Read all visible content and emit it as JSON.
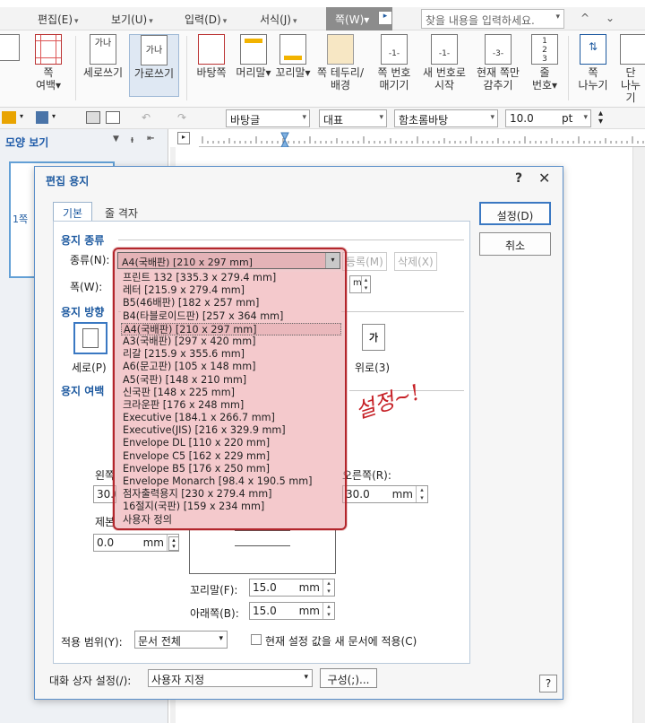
{
  "menus": [
    {
      "label": "편집(E)"
    },
    {
      "label": "보기(U)"
    },
    {
      "label": "입력(D)"
    },
    {
      "label": "서식(J)"
    },
    {
      "label": "쪽(W)"
    }
  ],
  "search": {
    "placeholder": "찾을 내용을 입력하세요."
  },
  "ribbon": {
    "items": [
      {
        "label": "쪽",
        "label2": "여백"
      },
      {
        "label": "세로쓰기",
        "label2": ""
      },
      {
        "label": "가로쓰기",
        "label2": ""
      },
      {
        "label": "바탕쪽",
        "label2": ""
      },
      {
        "label": "머리말",
        "label2": ""
      },
      {
        "label": "꼬리말",
        "label2": ""
      },
      {
        "label": "쪽 테두리/",
        "label2": "배경"
      },
      {
        "label": "쪽 번호",
        "label2": "매기기"
      },
      {
        "label": "새 번호로",
        "label2": "시작"
      },
      {
        "label": "현재 쪽만",
        "label2": "감추기"
      },
      {
        "label": "줄",
        "label2": "번호"
      },
      {
        "label": "쪽",
        "label2": "나누기"
      },
      {
        "label": "단",
        "label2": "나누기"
      }
    ],
    "icon_text": {
      "vertical": "가나",
      "horizontal": "가나"
    }
  },
  "toolbar2": {
    "style": "바탕글",
    "para": "대표",
    "font": "함초롬바탕",
    "size": "10.0",
    "unit": "pt"
  },
  "leftpane": {
    "title": "모양 보기",
    "page_label": "1쪽"
  },
  "dialog": {
    "title": "편집 용지",
    "help": "?",
    "close": "✕",
    "tabs": [
      "기본",
      "줄 격자"
    ],
    "sections": {
      "paper_type": "용지 종류",
      "orientation": "용지 방향",
      "margin": "용지 여백"
    },
    "kind_label": "종류(N):",
    "selected_paper": "A4(국배판) [210 x 297 mm]",
    "register": "등록(M)",
    "delete": "삭제(X)",
    "width_label": "폭(W):",
    "orient_portrait": "세로(P)",
    "orient_landscape": "위로(3)",
    "orient_glyph": "가",
    "left_label": "왼쪽",
    "right_label": "오른쪽(R):",
    "binding_label": "제본",
    "left_val": "30.0",
    "right_val": "30.0",
    "binding_val": "0.0",
    "footer_label": "꼬리말(F):",
    "bottom_label": "아래쪽(B):",
    "footer_val": "15.0",
    "bottom_val": "15.0",
    "unit": "mm",
    "scope_label": "적용 범위(Y):",
    "scope_val": "문서 전체",
    "apply_new": "현재 설정 값을 새 문서에 적용(C)",
    "dlg_setting_label": "대화 상자 설정(/):",
    "dlg_setting_val": "사용자 지정",
    "compose": "구성(;)...",
    "ok": "설정(D)",
    "cancel": "취소",
    "bottom_help": "?"
  },
  "paper_options": [
    "프린트 132 [335.3 x 279.4 mm]",
    "레터 [215.9 x 279.4 mm]",
    "B5(46배판) [182 x 257 mm]",
    "B4(타블로이드판) [257 x 364 mm]",
    "A4(국배판) [210 x 297 mm]",
    "A3(국배판) [297 x 420 mm]",
    "리갈 [215.9 x 355.6 mm]",
    "A6(문고판) [105 x 148 mm]",
    "A5(국판) [148 x 210 mm]",
    "신국판 [148 x 225 mm]",
    "크라운판 [176 x 248 mm]",
    "Executive [184.1 x 266.7 mm]",
    "Executive(JIS) [216 x 329.9 mm]",
    "Envelope DL [110 x 220 mm]",
    "Envelope C5 [162 x 229 mm]",
    "Envelope B5 [176 x 250 mm]",
    "Envelope Monarch [98.4 x 190.5 mm]",
    "점자출력용지 [230 x 279.4 mm]",
    "16절지(국판) [159 x 234 mm]",
    "사용자 정의"
  ],
  "annotation": "설정~!",
  "colors": {
    "accent": "#1e5aa0",
    "highlight": "#b3262c"
  }
}
